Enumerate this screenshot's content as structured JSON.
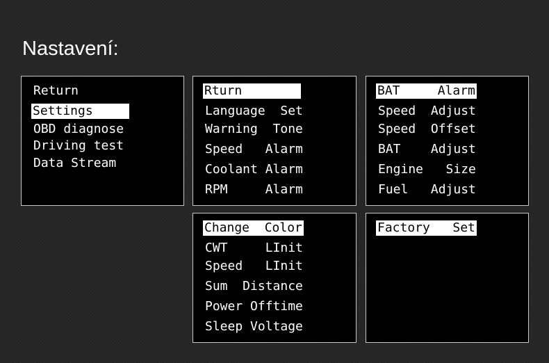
{
  "header": {
    "title": "Nastavení:"
  },
  "menus": {
    "main": {
      "items": [
        "Return",
        "Settings",
        "OBD diagnose",
        "Driving test",
        "Data Stream"
      ],
      "selected": "Settings"
    },
    "settings_page1": {
      "items": [
        "Rturn",
        "Language  Set",
        "Warning  Tone",
        "Speed   Alarm",
        "Coolant Alarm",
        "RPM     Alarm"
      ],
      "selected": "Rturn"
    },
    "settings_page2": {
      "items": [
        "BAT     Alarm",
        "Speed  Adjust",
        "Speed  Offset",
        "BAT    Adjust",
        "Engine   Size",
        "Fuel   Adjust"
      ],
      "selected": "BAT     Alarm"
    },
    "settings_page3": {
      "items": [
        "Change  Color",
        "CWT     LInit",
        "Speed   LInit",
        "Sum  Distance",
        "Power Offtime",
        "Sleep Voltage"
      ],
      "selected": "Change  Color"
    },
    "settings_page4": {
      "items": [
        "Factory   Set"
      ],
      "selected": "Factory   Set"
    }
  },
  "colors": {
    "background": "#262626",
    "panel": "#000000",
    "panel_border": "#c8c8c8",
    "highlight": "#ffffff",
    "text": "#ffffff"
  }
}
